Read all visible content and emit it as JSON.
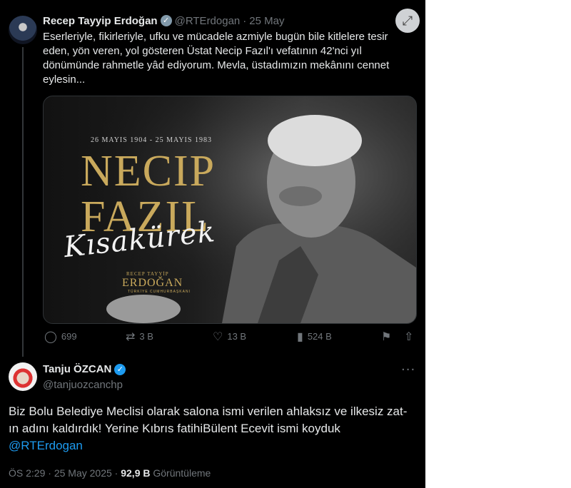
{
  "quoted_tweet": {
    "author_name": "Recep Tayyip Erdoğan",
    "handle": "@RTErdogan",
    "separator": "·",
    "date": "25 May",
    "text": "Eserleriyle, fikirleriyle, ufku ve mücadele azmiyle bugün bile kitlelere tesir eden, yön veren, yol gösteren Üstat Necip Fazıl'ı vefatının 42'nci yıl dönümünde rahmetle yâd ediyorum. Mevla, üstadımızın mekânını cennet eylesin...",
    "image": {
      "dates": "26 MAYIS 1904 - 25 MAYIS 1983",
      "name_line1": "NECIP",
      "name_line2": "FAZIL",
      "signature": "Kısakürek",
      "footer_small": "RECEP TAYYİP",
      "footer_large": "ERDOĞAN",
      "footer_office": "TÜRKİYE CUMHURBAŞKANI"
    },
    "actions": {
      "replies": "699",
      "reposts": "3 B",
      "likes": "13 B",
      "views": "524 B"
    }
  },
  "main_tweet": {
    "author_name": "Tanju ÖZCAN",
    "handle": "@tanjuozcanchp",
    "text_before_mention": "Biz Bolu Belediye Meclisi olarak salona ismi verilen ahlaksız ve ilkesiz zat-ın adını kaldırdık! Yerine Kıbrıs fatihiBülent Ecevit ismi koyduk",
    "mention": "@RTErdogan",
    "time": "ÖS 2:29",
    "date": "25 May 2025",
    "views_count": "92,9 B",
    "views_label": "Görüntüleme"
  },
  "colors": {
    "background": "#000000",
    "text": "#e7e9ea",
    "secondary": "#71767b",
    "accent": "#1d9bf0",
    "gold": "#c9a95c"
  },
  "icons": [
    "verified-badge-icon",
    "expand-icon",
    "reply-icon",
    "repost-icon",
    "like-icon",
    "views-icon",
    "bookmark-icon",
    "share-icon",
    "more-icon"
  ]
}
